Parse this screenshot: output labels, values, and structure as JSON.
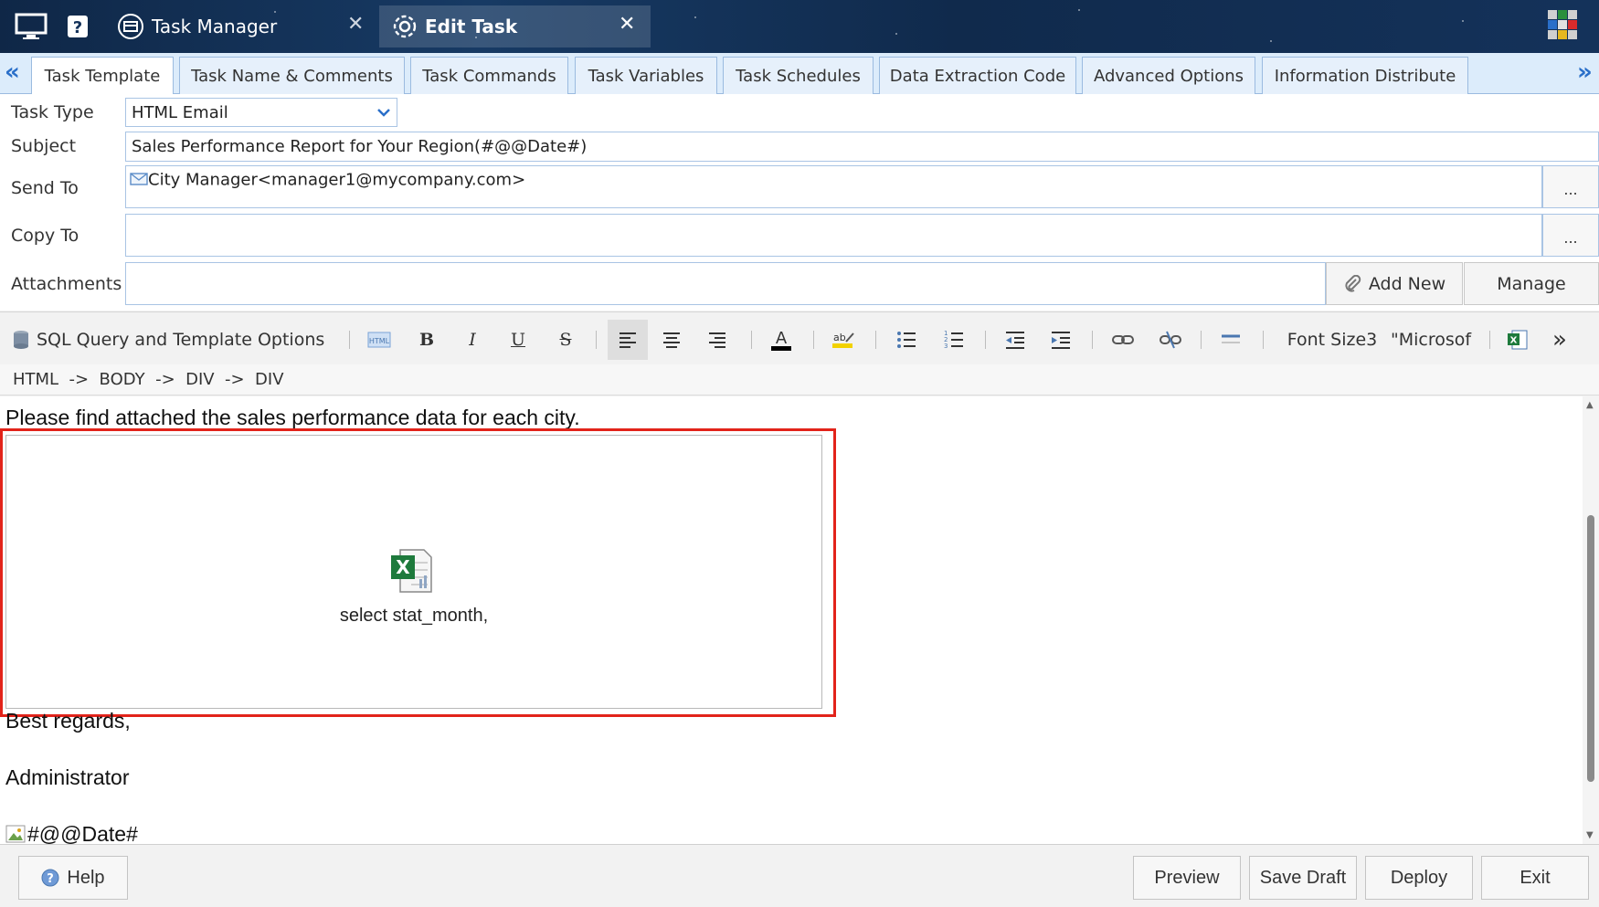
{
  "topbar": {
    "tabs": [
      {
        "label": "Task Manager",
        "active": false
      },
      {
        "label": "Edit Task",
        "active": true
      }
    ]
  },
  "task_tabs": {
    "items": [
      "Task Template",
      "Task Name & Comments",
      "Task Commands",
      "Task Variables",
      "Task Schedules",
      "Data Extraction Code",
      "Advanced Options",
      "Information Distribute"
    ],
    "active": "Task Template"
  },
  "form": {
    "task_type_label": "Task Type",
    "task_type_value": "HTML Email",
    "subject_label": "Subject",
    "subject_value": "Sales Performance Report for Your Region(#@@Date#)",
    "send_to_label": "Send To",
    "send_to_value": "City Manager<manager1@mycompany.com>",
    "copy_to_label": "Copy To",
    "copy_to_value": "",
    "ellipsis": "...",
    "attachments_label": "Attachments",
    "add_new_label": "Add New",
    "manage_label": "Manage"
  },
  "toolbar": {
    "sql_label": "SQL Query and Template Options",
    "font_size_label": "Font Size3",
    "font_name_label": "\"Microsof"
  },
  "breadcrumb": "HTML  ->  BODY  ->  DIV  ->  DIV",
  "editor": {
    "line1": "Please find attached the sales performance data for each city.",
    "embed_caption": "select stat_month,",
    "regards": "Best regards,",
    "signature": "Administrator",
    "image_alt": "#@@Date#"
  },
  "bottom": {
    "help_label": "Help",
    "preview_label": "Preview",
    "save_draft_label": "Save Draft",
    "deploy_label": "Deploy",
    "exit_label": "Exit"
  },
  "colors": {
    "topbar": "#14325a",
    "tab_strip": "#dcecfb",
    "accent": "#2a6fc9",
    "highlight_box": "#e2231a",
    "excel_green": "#1e7a3c"
  },
  "icons": [
    "monitor-icon",
    "help-icon",
    "task-manager-icon",
    "gear-icon",
    "close-icon",
    "app-logo-icon",
    "mail-icon",
    "paperclip-icon",
    "database-icon",
    "excel-icon",
    "help-circle-icon"
  ]
}
